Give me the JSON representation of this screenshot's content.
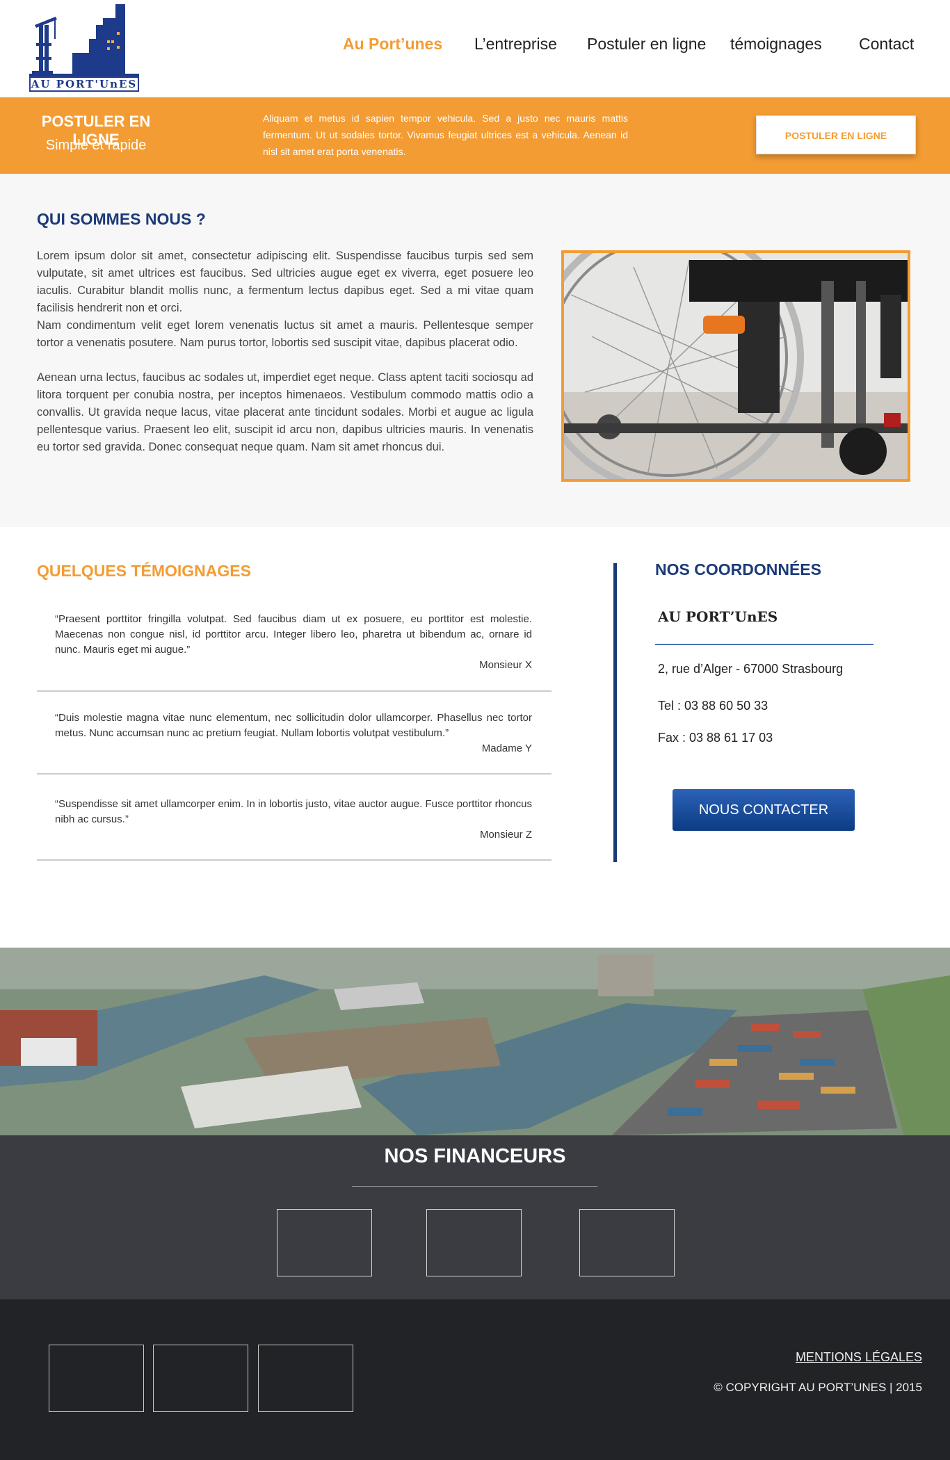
{
  "header": {
    "logo_text": "AU PORT'UnES",
    "nav": [
      {
        "label": "Au Port’unes",
        "active": true
      },
      {
        "label": "L’entreprise",
        "active": false
      },
      {
        "label": "Postuler en ligne",
        "active": false
      },
      {
        "label": "témoignages",
        "active": false
      },
      {
        "label": "Contact",
        "active": false
      }
    ]
  },
  "band": {
    "title": "POSTULER EN LIGNE",
    "subtitle": "Simple et rapide",
    "text": "Aliquam et metus id sapien tempor vehicula. Sed a justo nec mauris mattis fermentum. Ut ut sodales tortor. Vivamus feugiat ultrices est a vehicula. Aenean id nisl sit amet erat porta venenatis.",
    "button": "POSTULER EN LIGNE"
  },
  "about": {
    "title": "QUI SOMMES NOUS ?",
    "p1": "Lorem ipsum dolor sit amet, consectetur adipiscing elit. Suspendisse faucibus turpis sed sem vulputate, sit amet ultrices est faucibus. Sed ultricies augue eget ex viverra, eget posuere leo iaculis. Curabitur blandit mollis nunc, a fermentum lectus dapibus eget. Sed a mi vitae quam facilisis hendrerit non et orci.",
    "p2": "Nam condimentum velit eget lorem venenatis luctus sit amet a mauris. Pellentesque semper tortor a venenatis posutere. Nam purus tortor, lobortis sed suscipit vitae, dapibus placerat odio.",
    "p3": "Aenean urna lectus, faucibus ac sodales ut, imperdiet eget neque. Class aptent taciti sociosqu ad litora torquent per conubia nostra, per inceptos himenaeos. Vestibulum commodo mattis odio a convallis. Ut gravida neque lacus, vitae placerat ante tincidunt sodales. Morbi et augue ac ligula pellentesque varius. Praesent leo elit, suscipit id arcu non, dapibus ultricies mauris. In venenatis eu tortor sed gravida. Donec consequat neque quam. Nam sit amet rhoncus dui."
  },
  "testimonials": {
    "title": "QUELQUES TÉMOIGNAGES",
    "items": [
      {
        "quote": "“Praesent porttitor fringilla volutpat. Sed faucibus diam ut ex posuere, eu porttitor est molestie. Maecenas non congue nisl, id porttitor arcu. Integer libero leo, pharetra ut bibendum ac, ornare id nunc. Mauris eget mi augue.”",
        "author": "Monsieur X"
      },
      {
        "quote": "“Duis molestie magna vitae nunc elementum, nec sollicitudin dolor ullamcorper. Phasellus nec tortor metus. Nunc accumsan nunc ac pretium feugiat. Nullam lobortis volutpat vestibulum.”",
        "author": "Madame Y"
      },
      {
        "quote": "“Suspendisse sit amet ullamcorper enim. In in lobortis justo, vitae auctor augue. Fusce porttitor rhoncus nibh ac cursus.”",
        "author": "Monsieur Z"
      }
    ]
  },
  "coordinates": {
    "title": "NOS COORDONNÉES",
    "name": "AU PORT’UnES",
    "address": "2, rue d’Alger - 67000 Strasbourg",
    "tel": "Tel : 03 88 60 50 33",
    "fax": "Fax : 03 88 61 17 03",
    "button": "NOUS CONTACTER"
  },
  "funders": {
    "title": "NOS FINANCEURS"
  },
  "footer": {
    "mentions": "MENTIONS LÉGALES",
    "copyright": "© COPYRIGHT AU PORT’UNES | 2015"
  },
  "colors": {
    "accent": "#f39c33",
    "navy": "#1b3a78",
    "button_blue": "#0b3b82",
    "funders_bg": "#3a3c41",
    "footer_bg": "#222326"
  }
}
